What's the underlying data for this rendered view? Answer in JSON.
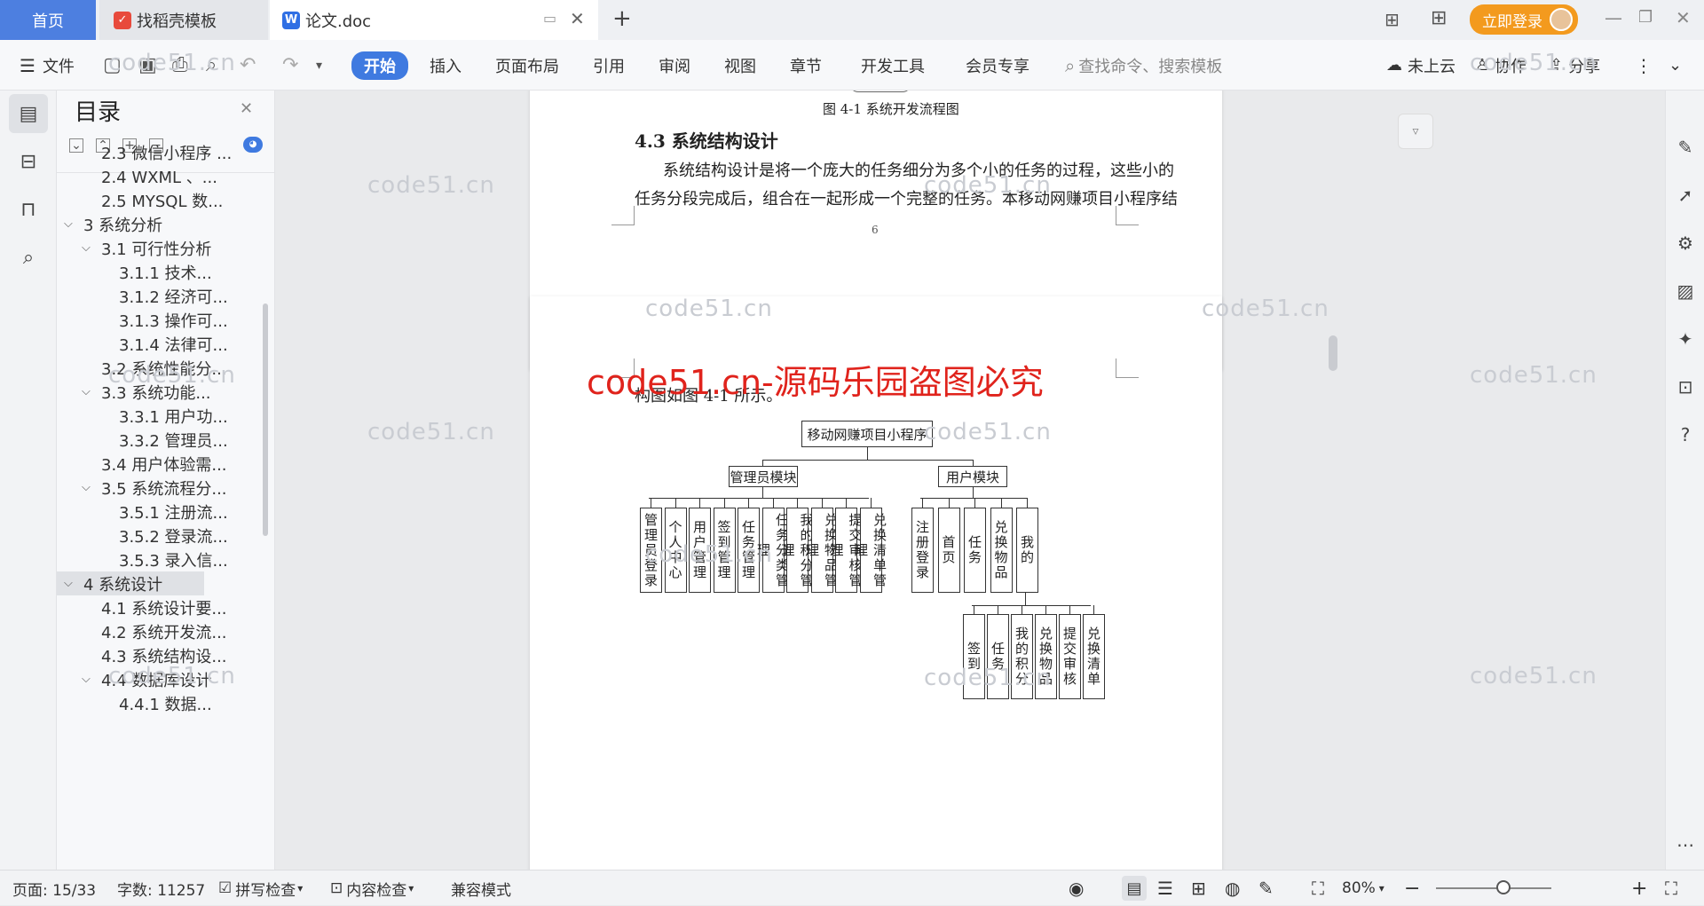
{
  "titlebar": {
    "tabs": [
      {
        "label": "首页"
      },
      {
        "label": "找稻壳模板"
      },
      {
        "label": "论文.doc"
      }
    ],
    "login_label": "立即登录"
  },
  "ribbon": {
    "file_label": "文件",
    "menus": [
      "开始",
      "插入",
      "页面布局",
      "引用",
      "审阅",
      "视图",
      "章节",
      "开发工具",
      "会员专享"
    ],
    "search_placeholder": "查找命令、搜索模板",
    "cloud_label": "未上云",
    "collab_label": "协作",
    "share_label": "分享"
  },
  "toc": {
    "title": "目录",
    "items": [
      {
        "label": "2.3 微信小程序 ...",
        "level": 2,
        "caret": ""
      },
      {
        "label": "2.4 WXML 、...",
        "level": 2,
        "caret": ""
      },
      {
        "label": "2.5 MYSQL 数...",
        "level": 2,
        "caret": ""
      },
      {
        "label": "3 系统分析",
        "level": 1,
        "caret": "open"
      },
      {
        "label": "3.1 可行性分析",
        "level": 2,
        "caret": "open"
      },
      {
        "label": "3.1.1  技术...",
        "level": 3,
        "caret": ""
      },
      {
        "label": "3.1.2 经济可...",
        "level": 3,
        "caret": ""
      },
      {
        "label": "3.1.3 操作可...",
        "level": 3,
        "caret": ""
      },
      {
        "label": "3.1.4 法律可...",
        "level": 3,
        "caret": ""
      },
      {
        "label": "3.2 系统性能分...",
        "level": 2,
        "caret": ""
      },
      {
        "label": "3.3    系统功能...",
        "level": 2,
        "caret": "open"
      },
      {
        "label": "3.3.1 用户功...",
        "level": 3,
        "caret": ""
      },
      {
        "label": "3.3.2 管理员...",
        "level": 3,
        "caret": ""
      },
      {
        "label": "3.4 用户体验需...",
        "level": 2,
        "caret": ""
      },
      {
        "label": "3.5 系统流程分...",
        "level": 2,
        "caret": "open"
      },
      {
        "label": "3.5.1 注册流...",
        "level": 3,
        "caret": ""
      },
      {
        "label": "3.5.2 登录流...",
        "level": 3,
        "caret": ""
      },
      {
        "label": "3.5.3 录入信...",
        "level": 3,
        "caret": ""
      },
      {
        "label": "4 系统设计",
        "level": 1,
        "caret": "open",
        "selected": true
      },
      {
        "label": "4.1 系统设计要...",
        "level": 2,
        "caret": ""
      },
      {
        "label": "4.2 系统开发流...",
        "level": 2,
        "caret": ""
      },
      {
        "label": "4.3 系统结构设...",
        "level": 2,
        "caret": ""
      },
      {
        "label": "4.4 数据库设计",
        "level": 2,
        "caret": "open"
      },
      {
        "label": "4.4.1 数据...",
        "level": 3,
        "caret": ""
      }
    ]
  },
  "document": {
    "page1": {
      "figure_caption": "图 4-1  系统开发流程图",
      "heading": "4.3 系统结构设计",
      "para_line1": "系统结构设计是将一个庞大的任务细分为多个小的任务的过程，这些小的",
      "para_line2": "任务分段完成后，组合在一起形成一个完整的任务。本移动网赚项目小程序结",
      "page_number": "6"
    },
    "page2": {
      "red_banner": "code51.cn-源码乐园盗图必究",
      "intro": "构图如图 4-1 所示。",
      "diagram": {
        "root": "移动网赚项目小程序",
        "admin_module": "管理员模块",
        "user_module": "用户模块",
        "admin_items": [
          "管理员登录",
          "个人中心",
          "用户管理",
          "签到管理",
          "任务管理",
          "任务分类管理",
          "我的积分管理",
          "兑换物品管理",
          "提交审核管理",
          "兑换清单管理"
        ],
        "user_items": [
          "注册登录",
          "首页",
          "任务",
          "兑换物品",
          "我的"
        ],
        "my_items": [
          "签到",
          "任务",
          "我的积分",
          "兑换物品",
          "提交审核",
          "兑换清单"
        ]
      }
    },
    "watermark": "code51.cn"
  },
  "status": {
    "page": "页面: 15/33",
    "words": "字数: 11257",
    "spell": "拼写检查",
    "content_check": "内容检查",
    "compat": "兼容模式",
    "zoom": "80%"
  },
  "colors": {
    "accent": "#3f7ae0",
    "login": "#f39a1e",
    "red_banner": "#e0231c"
  }
}
